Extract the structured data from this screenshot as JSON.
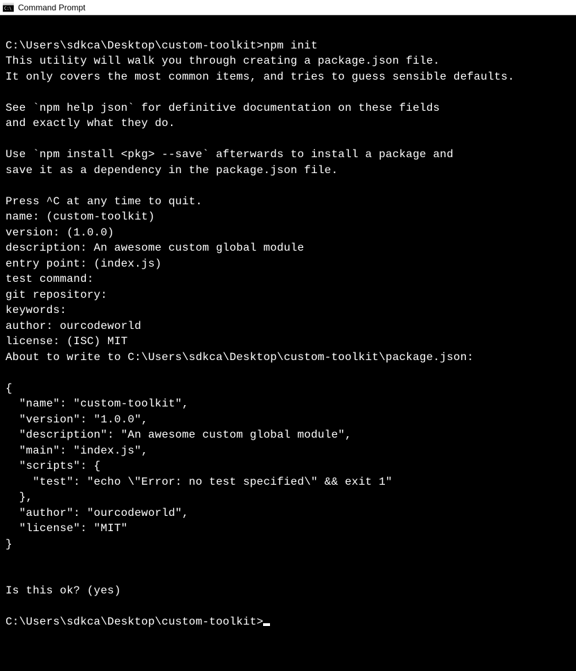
{
  "window": {
    "title": "Command Prompt"
  },
  "terminal": {
    "lines": [
      "",
      "C:\\Users\\sdkca\\Desktop\\custom-toolkit>npm init",
      "This utility will walk you through creating a package.json file.",
      "It only covers the most common items, and tries to guess sensible defaults.",
      "",
      "See `npm help json` for definitive documentation on these fields",
      "and exactly what they do.",
      "",
      "Use `npm install <pkg> --save` afterwards to install a package and",
      "save it as a dependency in the package.json file.",
      "",
      "Press ^C at any time to quit.",
      "name: (custom-toolkit)",
      "version: (1.0.0)",
      "description: An awesome custom global module",
      "entry point: (index.js)",
      "test command:",
      "git repository:",
      "keywords:",
      "author: ourcodeworld",
      "license: (ISC) MIT",
      "About to write to C:\\Users\\sdkca\\Desktop\\custom-toolkit\\package.json:",
      "",
      "{",
      "  \"name\": \"custom-toolkit\",",
      "  \"version\": \"1.0.0\",",
      "  \"description\": \"An awesome custom global module\",",
      "  \"main\": \"index.js\",",
      "  \"scripts\": {",
      "    \"test\": \"echo \\\"Error: no test specified\\\" && exit 1\"",
      "  },",
      "  \"author\": \"ourcodeworld\",",
      "  \"license\": \"MIT\"",
      "}",
      "",
      "",
      "Is this ok? (yes)",
      "",
      "C:\\Users\\sdkca\\Desktop\\custom-toolkit>"
    ]
  }
}
